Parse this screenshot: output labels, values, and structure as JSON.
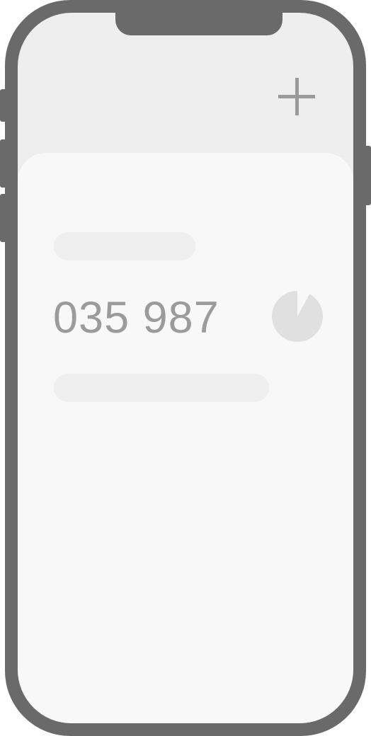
{
  "header": {
    "add_icon": "plus-icon"
  },
  "account": {
    "code": "035 987",
    "timer_remaining_fraction": 0.92,
    "timer_icon": "countdown-pie-icon"
  },
  "colors": {
    "frame": "#6a6a6a",
    "screen_bg": "#eeeeee",
    "card_bg": "#f8f8f8",
    "placeholder": "#efefef",
    "code_text": "#9b9b9b",
    "timer": "#e0e0e0",
    "add_icon": "#9a9a9a"
  }
}
